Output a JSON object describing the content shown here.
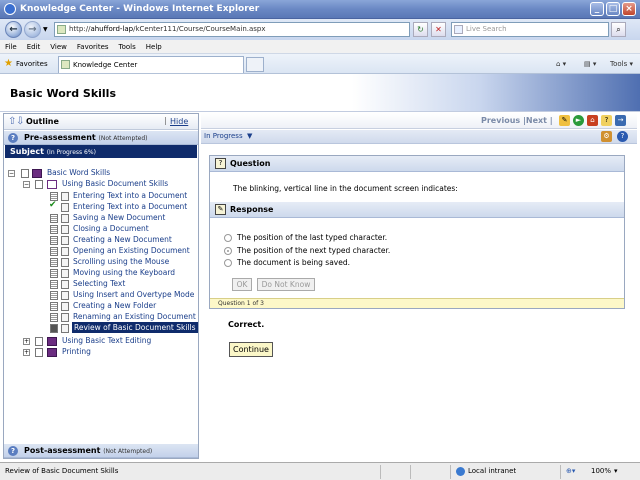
{
  "window": {
    "title": "Knowledge Center - Windows Internet Explorer"
  },
  "address": {
    "prefix": "http://",
    "host": "ahufford-lap",
    "path": "/kCenter111/Course/CourseMain.aspx"
  },
  "search": {
    "placeholder": "Live Search"
  },
  "menu": [
    "File",
    "Edit",
    "View",
    "Favorites",
    "Tools",
    "Help"
  ],
  "favorites": {
    "label": "Favorites",
    "tab_title": "Knowledge Center",
    "tools_label": "Tools"
  },
  "page": {
    "title": "Basic Word Skills"
  },
  "outline": {
    "label": "Outline",
    "hide_label": "Hide",
    "separator": "|",
    "pre_assessment": {
      "label": "Pre-assessment",
      "status": "(Not Attempted)"
    },
    "subject": {
      "label": "Subject",
      "status": "(In Progress 6%)"
    },
    "post_assessment": {
      "label": "Post-assessment",
      "status": "(Not Attempted)"
    },
    "tree": {
      "root": "Basic Word Skills",
      "module1": "Using Basic Document Skills",
      "items": [
        "Entering Text into a Document",
        "Entering Text into a Document",
        "Saving a New Document",
        "Closing a Document",
        "Creating a New Document",
        "Opening an Existing Document",
        "Scrolling using the Mouse",
        "Moving using the Keyboard",
        "Selecting Text",
        "Using Insert and Overtype Mode",
        "Creating a New Folder",
        "Renaming an Existing Document",
        "Review of Basic Document Skills"
      ],
      "module2": "Using Basic Text Editing",
      "module3": "Printing"
    }
  },
  "nav": {
    "previous": "Previous",
    "next": "Next",
    "sep": "|",
    "status_dropdown": "In Progress"
  },
  "question": {
    "header": "Question",
    "text": "The blinking, vertical line in the document screen indicates:",
    "response_header": "Response",
    "options": [
      {
        "text": "The position of the last typed character.",
        "selected": false
      },
      {
        "text": "The position of the next typed character.",
        "selected": true
      },
      {
        "text": "The document is being saved.",
        "selected": false
      }
    ],
    "ok_label": "OK",
    "dont_know_label": "Do Not Know",
    "counter": "Question 1 of 3"
  },
  "feedback": {
    "text": "Correct.",
    "continue_label": "Continue"
  },
  "statusbar": {
    "text": "Review of Basic Document Skills",
    "zone": "Local intranet",
    "zoom": "100%"
  }
}
